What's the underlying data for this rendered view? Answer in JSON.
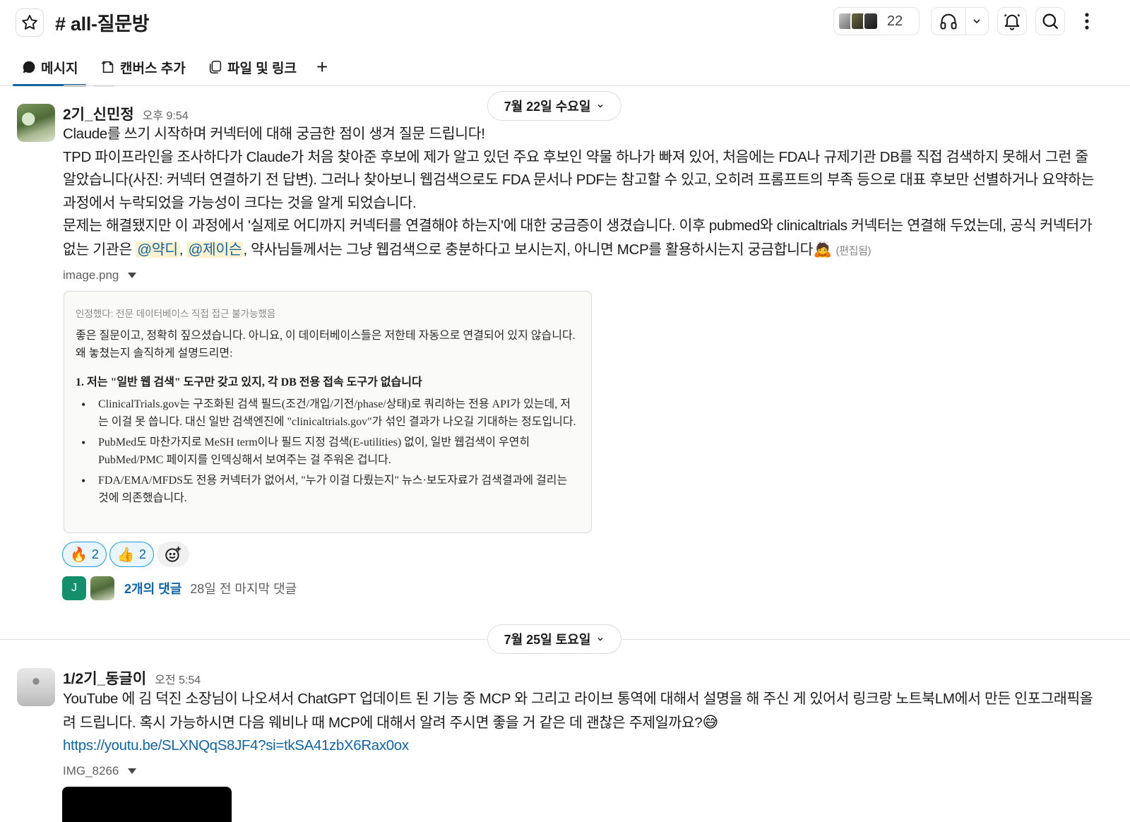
{
  "header": {
    "channel_title": "# all-질문방",
    "member_count": "22"
  },
  "tabs": [
    {
      "label": "메시지",
      "active": true
    },
    {
      "label": "캔버스 추가"
    },
    {
      "label": "파일 및 링크"
    },
    {
      "label": "+"
    }
  ],
  "dates": {
    "first": "7월 22일 수요일",
    "second": "7월 25일 토요일"
  },
  "message1": {
    "author": "2기_신민정",
    "time": "오후 9:54",
    "line1": "Claude를 쓰기 시작하며 커넥터에 대해 궁금한 점이 생겨 질문 드립니다!",
    "para2": "TPD 파이프라인을 조사하다가 Claude가 처음 찾아준 후보에 제가 알고 있던 주요 후보인 약물 하나가 빠져 있어, 처음에는 FDA나 규제기관 DB를 직접 검색하지 못해서 그런 줄 알았습니다(사진: 커넥터 연결하기 전 답변). 그러나 찾아보니 웹검색으로도 FDA 문서나 PDF는 참고할 수 있고, 오히려 프롬프트의 부족 등으로 대표 후보만 선별하거나 요약하는 과정에서 누락되었을 가능성이 크다는 것을 알게 되었습니다.",
    "para3_start": "문제는 해결됐지만 이 과정에서 '실제로 어디까지 커넥터를 연결해야 하는지'에 대한 궁금증이 생겼습니다. 이후 pubmed와 clinicaltrials 커넥터는 연결해 두었는데, 공식 커넥터가 없는 기관은 ",
    "mention1": "@약디",
    "comma": ", ",
    "mention2": "@제이슨",
    "para3_end": ", 약사님들께서는 그냥 웹검색으로 충분하다고 보시는지, 아니면 MCP를 활용하시는지 궁금합니다",
    "emoji": "🙇",
    "edited": "(편집됨)",
    "file_name": "image.png"
  },
  "image_card": {
    "subtitle": "인정했다: 전문 데이터베이스 직접 접근 불가능했음",
    "paragraph": "좋은 질문이고, 정확히 짚으셨습니다. 아니요, 이 데이터베이스들은 저한테 자동으로 연결되어 있지 않습니다. 왜 놓쳤는지 솔직하게 설명드리면:",
    "heading": "1. 저는 \"일반 웹 검색\" 도구만 갖고 있지, 각 DB 전용 접속 도구가 없습니다",
    "bullets": [
      "ClinicalTrials.gov는 구조화된 검색 필드(조건/개입/기전/phase/상태)로 쿼리하는 전용 API가 있는데, 저는 이걸 못 씁니다. 대신 일반 검색엔진에 \"clinicaltrials.gov\"가 섞인 결과가 나오길 기대하는 정도입니다.",
      "PubMed도 마찬가지로 MeSH term이나 필드 지정 검색(E-utilities) 없이, 일반 웹검색이 우연히 PubMed/PMC 페이지를 인덱싱해서 보여주는 걸 주워온 겁니다.",
      "FDA/EMA/MFDS도 전용 커넥터가 없어서, \"누가 이걸 다뤘는지\" 뉴스·보도자료가 검색결과에 걸리는 것에 의존했습니다."
    ]
  },
  "reactions": [
    {
      "emoji": "🔥",
      "count": "2"
    },
    {
      "emoji": "👍",
      "count": "2"
    }
  ],
  "thread": {
    "avatar_letter": "J",
    "count_label": "2개의 댓글",
    "last_reply": "28일 전 마지막 댓글"
  },
  "message2": {
    "author": "1/2기_동글이",
    "time": "오전 5:54",
    "body": "YouTube 에 김 덕진 소장님이 나오셔서 ChatGPT 업데이트 된 기능 중 MCP 와 그리고 라이브 통역에 대해서 설명을 해 주신 게 있어서 링크랑 노트북LM에서 만든 인포그래픽올려 드립니다. 혹시 가능하시면 다음 웨비나 때 MCP에 대해서 알려 주시면 좋을 거 같은 데 괜찮은 주제일까요?",
    "emoji": "😅",
    "link": "https://youtu.be/SLXNQqS8JF4?si=tkSA41zbX6Rax0ox",
    "file_name": "IMG_8266"
  },
  "colors": {
    "accent": "#1264a3",
    "mention_bg": "#fdf2d0",
    "reaction_border": "#1d9bd1",
    "thread_avatar": "#138f6b"
  }
}
